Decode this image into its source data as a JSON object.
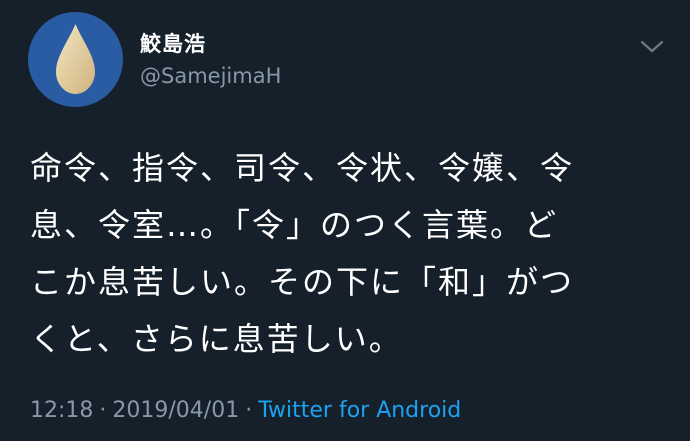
{
  "user": {
    "display_name": "鮫島浩",
    "handle": "@SamejimaH",
    "avatar_icon": "water-drop-icon"
  },
  "menu": {
    "caret_icon": "chevron-down-icon"
  },
  "tweet": {
    "lines": [
      "命令、指令、司令、令状、令嬢、令",
      "息、令室…。「令」のつく言葉。ど",
      "こか息苦しい。その下に「和」がつ",
      "くと、さらに息苦しい。"
    ]
  },
  "meta": {
    "time": "12:18",
    "date": "2019/04/01",
    "separator": "·",
    "source": "Twitter for Android"
  },
  "colors": {
    "background": "#15202b",
    "text_primary": "#ffffff",
    "text_secondary": "#8899a6",
    "link": "#1da1f2",
    "avatar_bg": "#2a5ca4",
    "drop": "#e7d4a8"
  }
}
